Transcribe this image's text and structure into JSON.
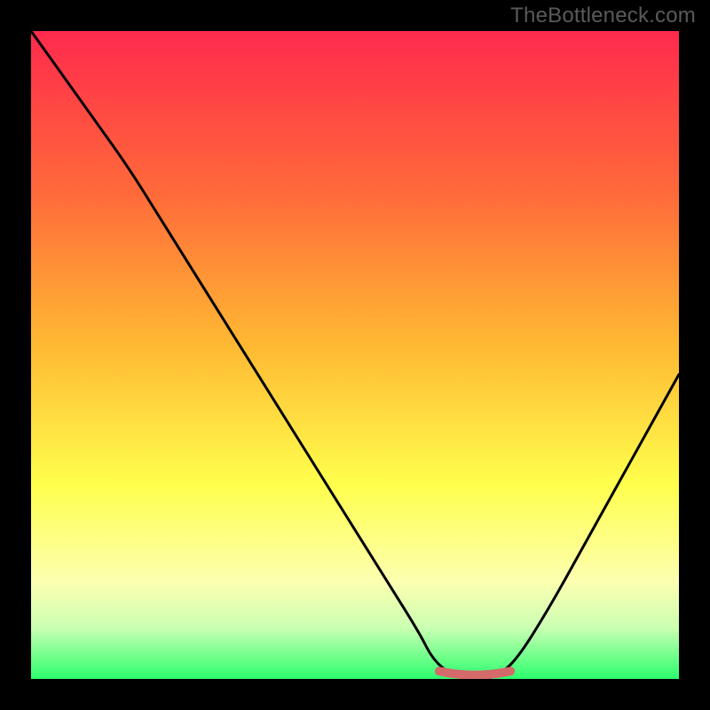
{
  "watermark": "TheBottleneck.com",
  "colors": {
    "red": "#ff2a4d",
    "orange": "#ffb733",
    "yellow": "#ffff4d",
    "lightyellow": "#fcffb0",
    "palegreen": "#ccffb3",
    "green": "#2cff6e",
    "curve": "#000000",
    "marker": "#d46a6a",
    "background": "#000000"
  },
  "chart_data": {
    "type": "line",
    "title": "",
    "xlabel": "",
    "ylabel": "",
    "xlim": [
      0,
      100
    ],
    "ylim": [
      0,
      100
    ],
    "x": [
      0,
      5,
      10,
      15,
      20,
      25,
      30,
      35,
      40,
      45,
      50,
      55,
      60,
      62,
      65,
      68,
      70,
      72,
      75,
      80,
      85,
      90,
      95,
      100
    ],
    "values": [
      100,
      93,
      86,
      79,
      71,
      63,
      55,
      47,
      39,
      31,
      23,
      15,
      7,
      3,
      0.5,
      0,
      0,
      0.5,
      3,
      11,
      20,
      29,
      38,
      47
    ],
    "flat_region_x": [
      63,
      74
    ],
    "marker_y": 0.5,
    "gradient_stops": [
      {
        "offset": 0.0,
        "color": "#ff2a4d"
      },
      {
        "offset": 0.25,
        "color": "#ff6a3a"
      },
      {
        "offset": 0.48,
        "color": "#ffb733"
      },
      {
        "offset": 0.7,
        "color": "#ffff4d"
      },
      {
        "offset": 0.85,
        "color": "#fcffb0"
      },
      {
        "offset": 0.92,
        "color": "#ccffb3"
      },
      {
        "offset": 1.0,
        "color": "#2cff6e"
      }
    ]
  }
}
